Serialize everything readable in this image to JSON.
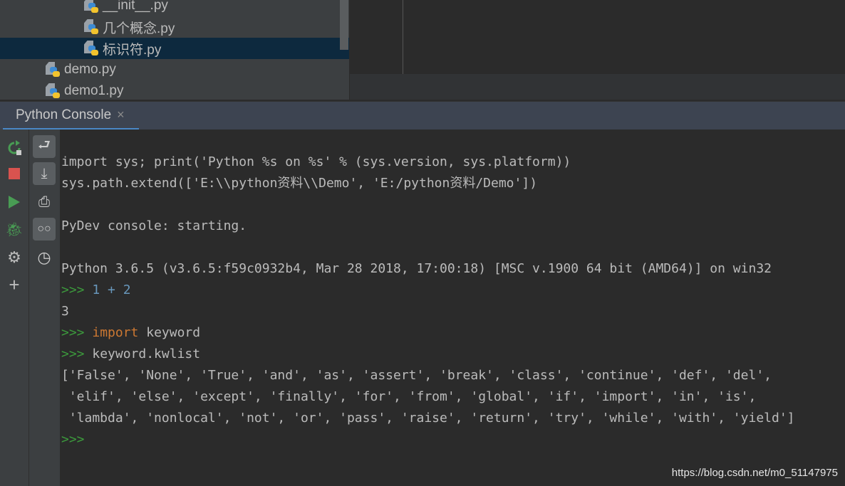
{
  "project_tree": {
    "items": [
      {
        "label": "__init__.py",
        "indent": 1,
        "selected": false
      },
      {
        "label": "几个概念.py",
        "indent": 1,
        "selected": false
      },
      {
        "label": "标识符.py",
        "indent": 1,
        "selected": true
      },
      {
        "label": "demo.py",
        "indent": 0,
        "selected": false
      },
      {
        "label": "demo1.py",
        "indent": 0,
        "selected": false
      }
    ]
  },
  "tabs": [
    {
      "label": "Python Console",
      "close": "×"
    }
  ],
  "toolbar_left": [
    "rerun-icon",
    "stop-icon",
    "run-icon",
    "debug-icon",
    "settings-icon",
    "add-icon"
  ],
  "toolbar_right": [
    "soft-wrap-icon",
    "scroll-to-end-icon",
    "print-icon",
    "show-variables-icon",
    "history-icon"
  ],
  "console": {
    "l1": "import sys; print('Python %s on %s' % (sys.version, sys.platform))",
    "l2": "sys.path.extend(['E:\\\\python资料\\\\Demo', 'E:/python资料/Demo'])",
    "l3": "PyDev console: starting.",
    "l4": "Python 3.6.5 (v3.6.5:f59c0932b4, Mar 28 2018, 17:00:18) [MSC v.1900 64 bit (AMD64)] on win32",
    "prompt": ">>> ",
    "in1": "1 + 2",
    "out1": "3",
    "in2_kw": "import",
    "in2_rest": " keyword",
    "in3": "keyword.kwlist",
    "out3a": "['False', 'None', 'True', 'and', 'as', 'assert', 'break', 'class', 'continue', 'def', 'del',",
    "out3b": " 'elif', 'else', 'except', 'finally', 'for', 'from', 'global', 'if', 'import', 'in', 'is',",
    "out3c": " 'lambda', 'nonlocal', 'not', 'or', 'pass', 'raise', 'return', 'try', 'while', 'with', 'yield']",
    "final_prompt": ">>>"
  },
  "watermark": "https://blog.csdn.net/m0_51147975",
  "colors": {
    "prompt": "#3c9a3c",
    "number": "#6897bb",
    "keyword": "#cc7832",
    "tab_underline": "#4a88c7",
    "selection": "#0d293e"
  }
}
